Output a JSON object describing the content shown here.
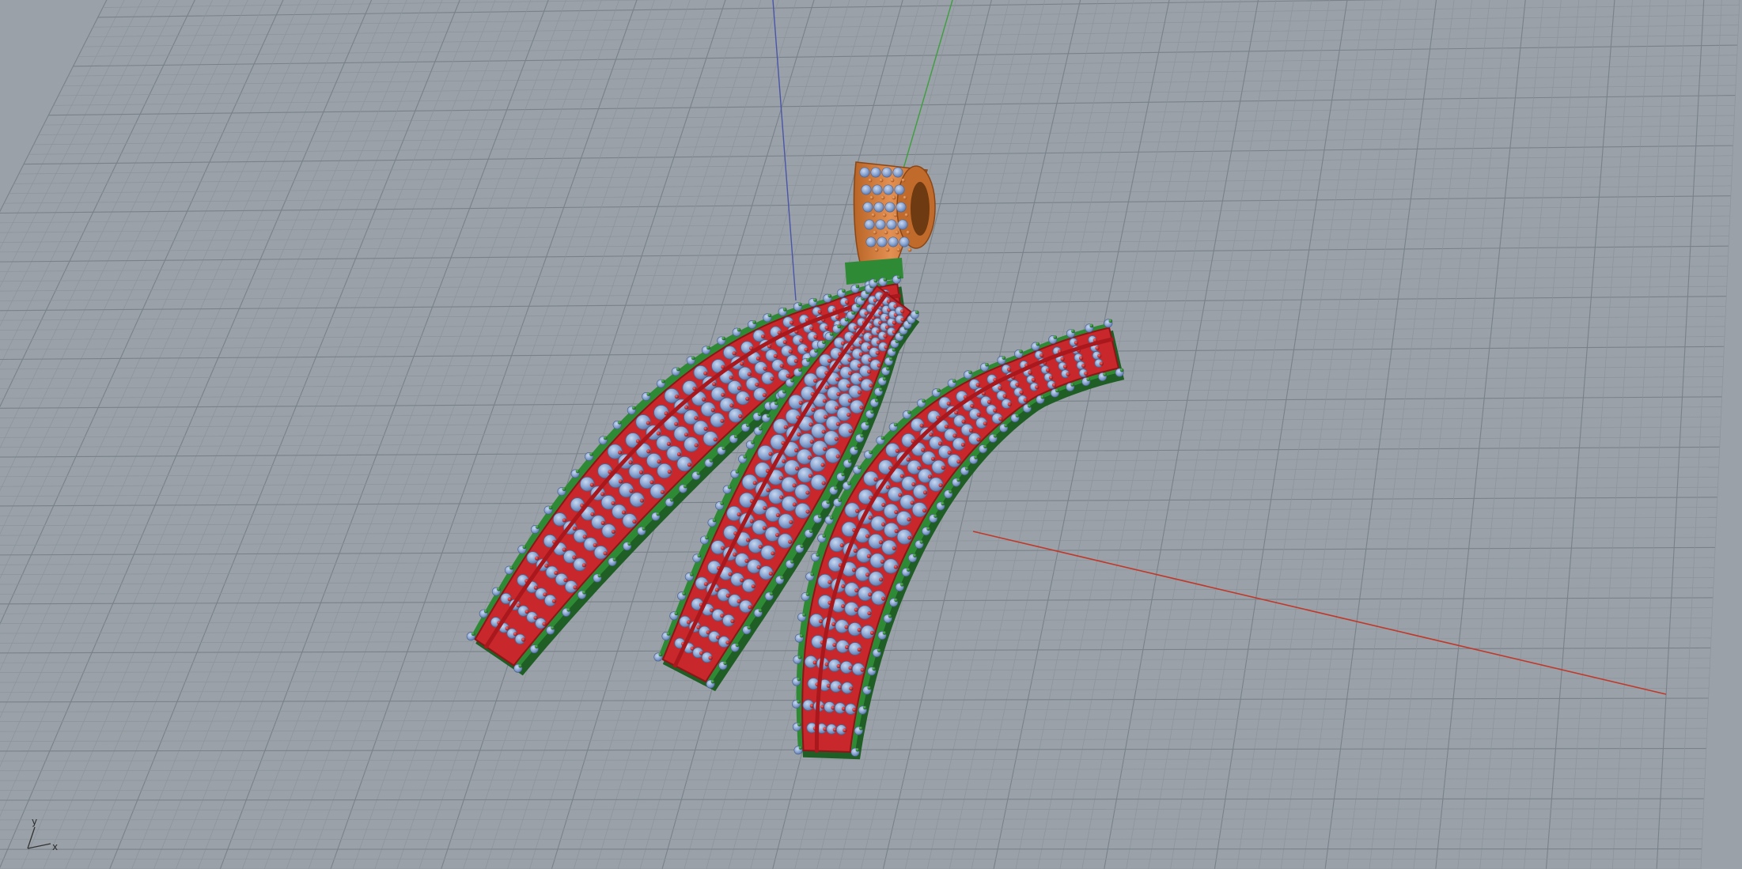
{
  "viewport": {
    "background": "#9aa1a8",
    "grid_minor_color": "#8c949b",
    "grid_major_color": "#79818a",
    "axis_x_color": "#c0392b",
    "axis_y_color": "#3f9e3f",
    "axis_z_color": "#4a55a8",
    "projection": "perspective"
  },
  "model": {
    "metal_colors": {
      "base": "#2f8a35",
      "setting": "#c8272b",
      "bail": "#d9803a"
    },
    "gem_color": "#8fa9d4",
    "bead_colors": {
      "green": "#236b2a",
      "red": "#b31d20",
      "orange": "#b76024"
    }
  },
  "triad": {
    "x_label": "x",
    "y_label": "y",
    "z_label": ""
  }
}
